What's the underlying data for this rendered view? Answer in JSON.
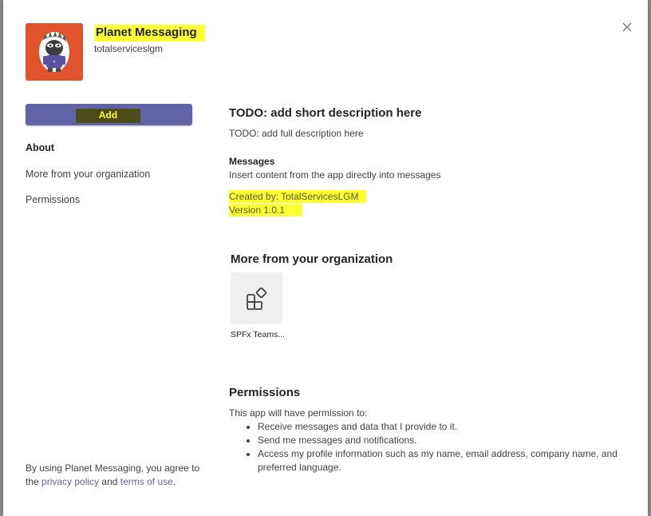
{
  "app": {
    "name": "Planet Messaging",
    "publisher": "totalserviceslgm",
    "icon": "mascot-logo",
    "icon_bg": "#e0532d"
  },
  "actions": {
    "add_label": "Add"
  },
  "nav": {
    "about": "About",
    "more_from_org": "More from your organization",
    "permissions": "Permissions"
  },
  "about": {
    "short_description": "TODO: add short description here",
    "full_description": "TODO: add full description here",
    "messages_title": "Messages",
    "messages_description": "Insert content from the app directly into messages",
    "created_by": "Created by: TotalServicesLGM",
    "version": "Version 1.0.1"
  },
  "org": {
    "title": "More from your organization",
    "apps": [
      {
        "label": "SPFx Teams...",
        "icon": "apps-add-icon"
      }
    ]
  },
  "permissions": {
    "title": "Permissions",
    "intro": "This app will have permission to:",
    "items": [
      "Receive messages and data that I provide to it.",
      "Send me messages and notifications.",
      "Access my profile information such as my name, email address, company name, and preferred language."
    ]
  },
  "footer": {
    "prefix": "By using Planet Messaging, you agree to the",
    "privacy_link": "privacy policy",
    "and": "and",
    "terms_link": "terms of use",
    "suffix": "."
  },
  "colors": {
    "accent": "#6264a7",
    "highlight": "#ffff33"
  }
}
